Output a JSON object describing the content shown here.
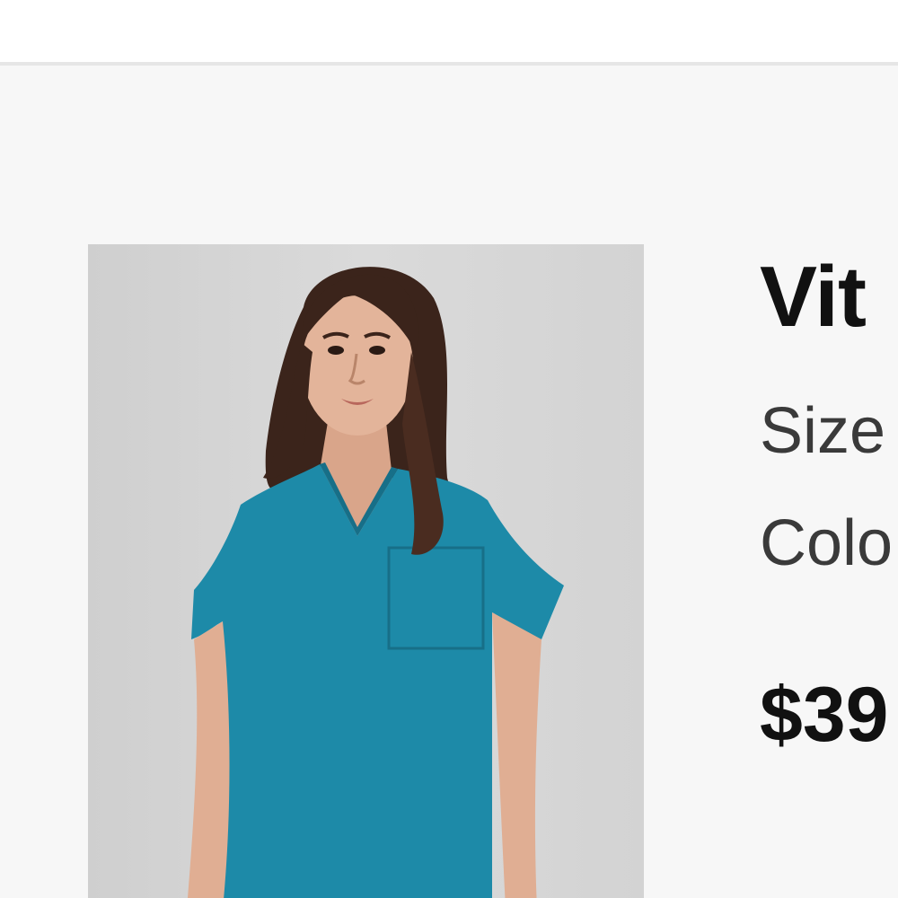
{
  "product": {
    "title": "Vit",
    "size_label": "Size",
    "color_label": "Colo",
    "price": "$39",
    "image": {
      "description_icon": "product-photo",
      "garment_color": "#1d8aa8"
    }
  },
  "colors": {
    "page_background": "#f7f7f7",
    "header_background": "#ffffff",
    "divider": "#e6e6e6",
    "title_text": "#111111",
    "secondary_text": "#3a3a3a"
  }
}
